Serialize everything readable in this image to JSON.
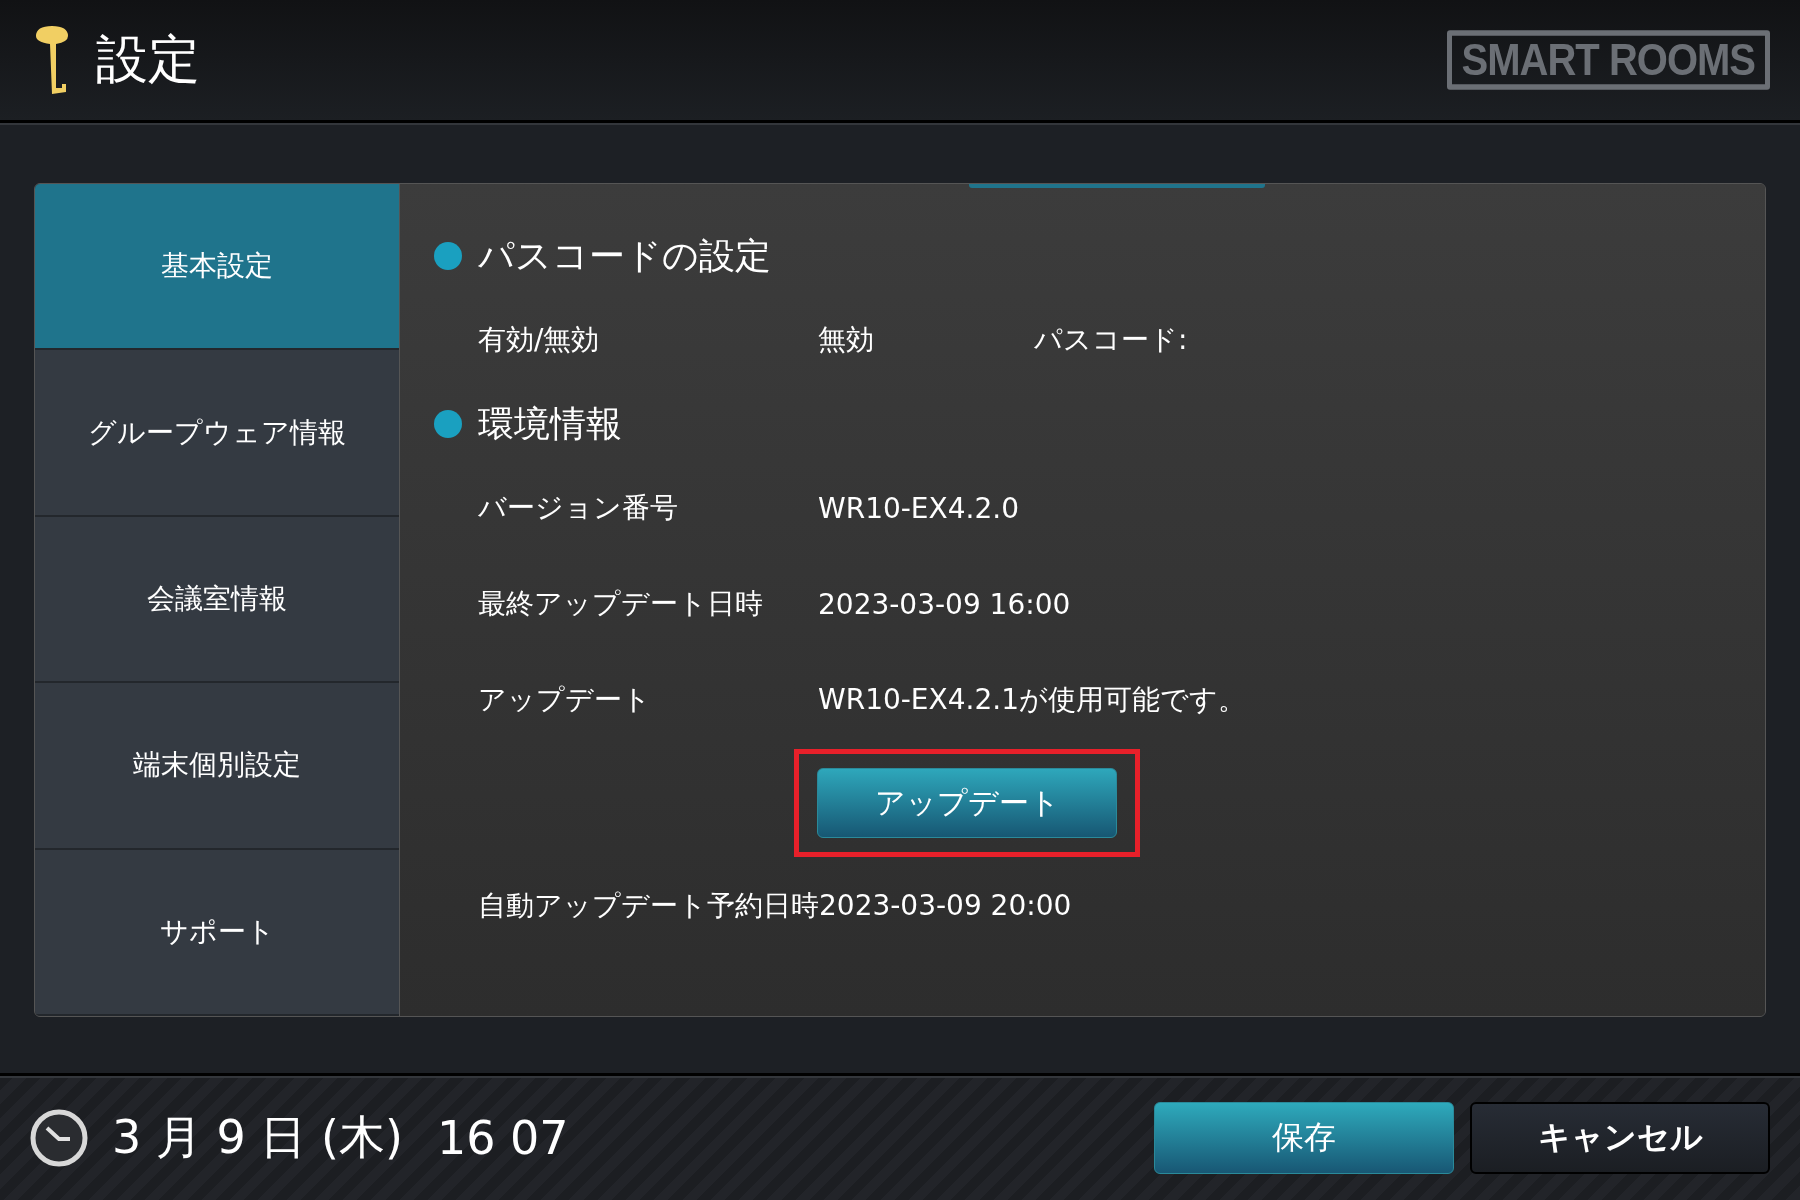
{
  "header": {
    "title": "設定",
    "logo": "SMART ROOMS"
  },
  "sidebar": {
    "items": [
      {
        "label": "基本設定",
        "selected": true
      },
      {
        "label": "グループウェア情報",
        "selected": false
      },
      {
        "label": "会議室情報",
        "selected": false
      },
      {
        "label": "端末個別設定",
        "selected": false
      },
      {
        "label": "サポート",
        "selected": false
      }
    ]
  },
  "sections": [
    {
      "title": "パスコードの設定",
      "rows": [
        {
          "kind": "triple",
          "label": "有効/無効",
          "value": "無効",
          "extra": "パスコード:"
        }
      ]
    },
    {
      "title": "環境情報",
      "rows": [
        {
          "kind": "pair",
          "label": "バージョン番号",
          "value": "WR10-EX4.2.0"
        },
        {
          "kind": "pair",
          "label": "最終アップデート日時",
          "value": "2023-03-09 16:00"
        },
        {
          "kind": "pair",
          "label": "アップデート",
          "value": "WR10-EX4.2.1が使用可能です。"
        },
        {
          "kind": "button",
          "label": "アップデート",
          "highlighted": true
        },
        {
          "kind": "note",
          "label": "自動アップデート予約日時2023-03-09 20:00"
        }
      ]
    }
  ],
  "footer": {
    "date": "3 月 9 日 (木)",
    "time": "16 07",
    "buttons": [
      {
        "label": "保存",
        "kind": "primary"
      },
      {
        "label": "キャンセル",
        "kind": "secondary"
      }
    ]
  }
}
